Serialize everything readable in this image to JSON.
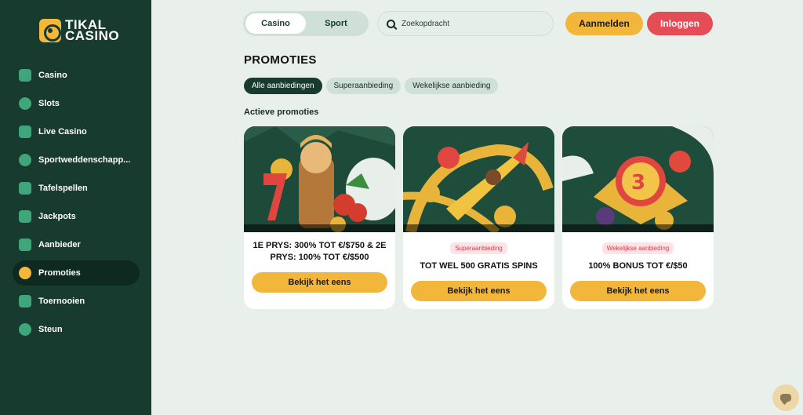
{
  "brand": {
    "logo_line1": "TIKAL",
    "logo_line2": "CASINO"
  },
  "sidebar": {
    "items": [
      {
        "label": "Casino",
        "icon": "slot-machine-icon"
      },
      {
        "label": "Slots",
        "icon": "slots-icon"
      },
      {
        "label": "Live Casino",
        "icon": "spade-icon"
      },
      {
        "label": "Sportweddenschapp...",
        "icon": "soccer-ball-icon"
      },
      {
        "label": "Tafelspellen",
        "icon": "cards-icon"
      },
      {
        "label": "Jackpots",
        "icon": "sparkle-icon"
      },
      {
        "label": "Aanbieder",
        "icon": "gamepad-icon"
      },
      {
        "label": "Promoties",
        "icon": "percent-icon",
        "active": true
      },
      {
        "label": "Toernooien",
        "icon": "ticket-icon"
      },
      {
        "label": "Steun",
        "icon": "chat-icon"
      }
    ]
  },
  "header": {
    "tabs": [
      "Casino",
      "Sport"
    ],
    "search_placeholder": "Zoekopdracht",
    "signup_label": "Aanmelden",
    "login_label": "Inloggen"
  },
  "main": {
    "title": "PROMOTIES",
    "filters": [
      "Alle aanbiedingen",
      "Superaanbieding",
      "Wekelijkse aanbieding"
    ],
    "section_title": "Actieve promoties",
    "cards": [
      {
        "badge": "",
        "title": "1E PRYS: 300% TOT €/$750 & 2E PRYS: 100% TOT €/$500",
        "button": "Bekijk het eens"
      },
      {
        "badge": "Superaanbieding",
        "title": "TOT WEL 500 GRATIS SPINS",
        "button": "Bekijk het eens"
      },
      {
        "badge": "Wekelijkse aanbieding",
        "title": "100% BONUS TOT €/$50",
        "button": "Bekijk het eens"
      }
    ]
  },
  "colors": {
    "sidebar": "#173b2e",
    "accent": "#f2b73a",
    "login": "#e44d55",
    "page": "#e9f0ec"
  }
}
